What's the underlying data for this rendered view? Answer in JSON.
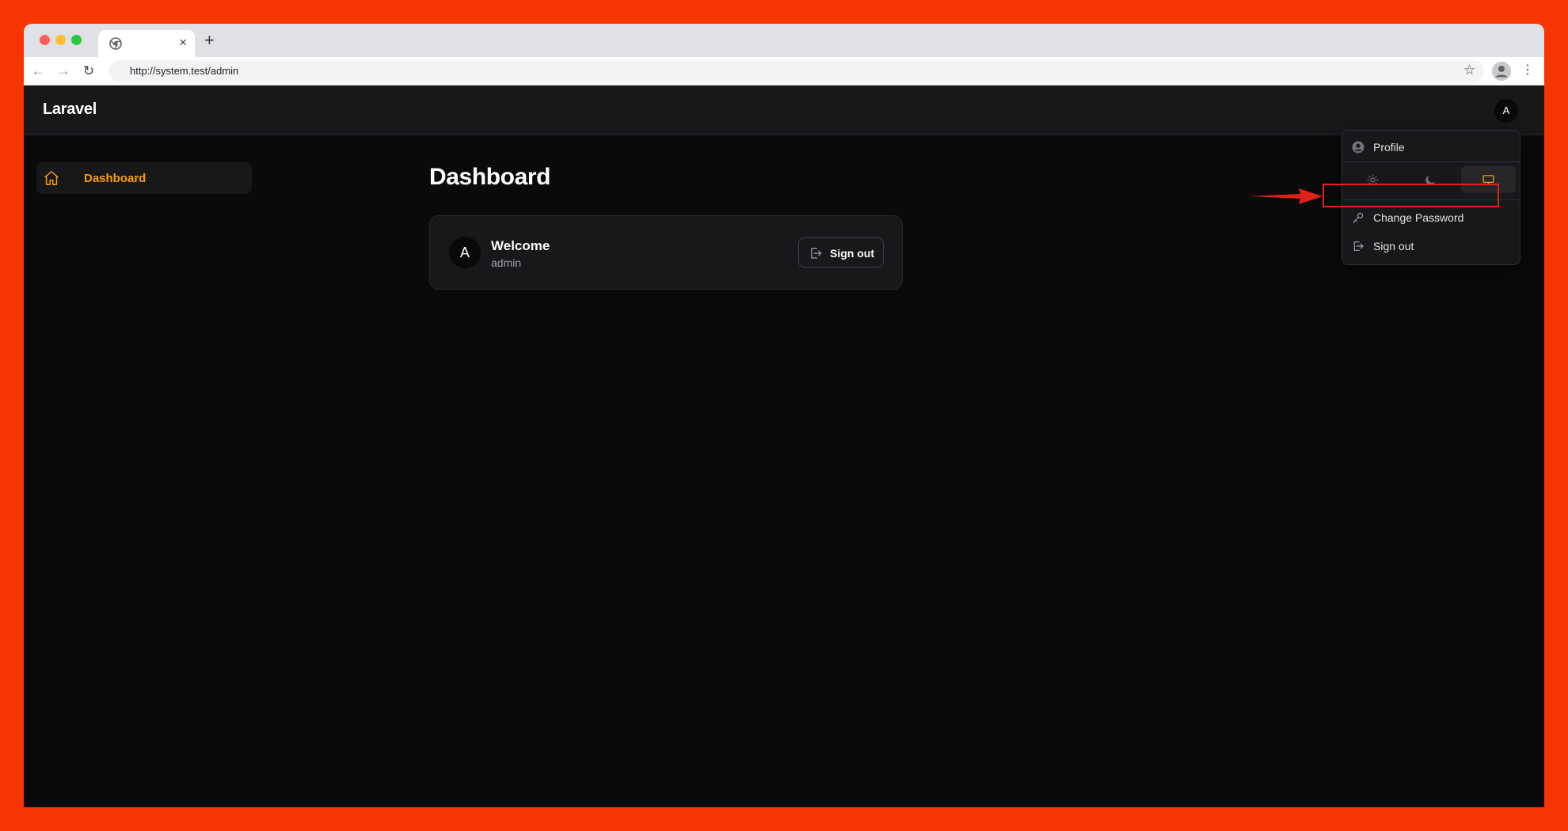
{
  "browser": {
    "url": "http://system.test/admin",
    "tab_close": "×",
    "new_tab": "+"
  },
  "app": {
    "brand": "Laravel",
    "user_initial": "A"
  },
  "sidebar": {
    "items": [
      {
        "label": "Dashboard",
        "icon": "home-icon",
        "active": true
      }
    ]
  },
  "main": {
    "title": "Dashboard",
    "welcome_card": {
      "avatar_initial": "A",
      "title": "Welcome",
      "username": "admin",
      "signout_label": "Sign out"
    }
  },
  "user_menu": {
    "profile_label": "Profile",
    "theme_options": [
      "light",
      "dark",
      "system"
    ],
    "theme_selected": "system",
    "change_password_label": "Change Password",
    "signout_label": "Sign out"
  },
  "colors": {
    "accent": "#f59e0b",
    "background": "#0a0a0c",
    "surface": "#18181b",
    "frame": "#f83500",
    "annotation": "#e0201a"
  }
}
